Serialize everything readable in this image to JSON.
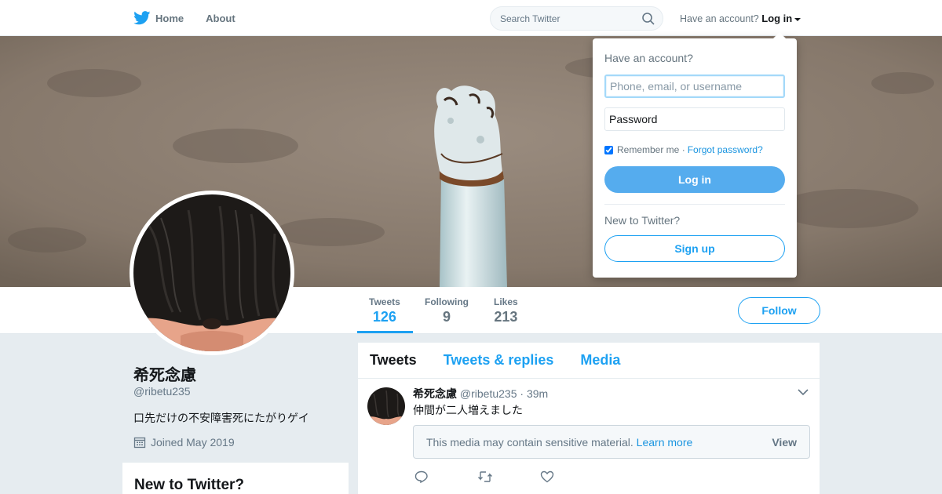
{
  "nav": {
    "home_label": "Home",
    "about_label": "About",
    "search_placeholder": "Search Twitter",
    "have_account_text": "Have an account?",
    "login_link": "Log in"
  },
  "profile": {
    "name": "希死念慮",
    "handle": "@ribetu235",
    "bio": "口先だけの不安障害死にたがりゲイ",
    "joined": "Joined May 2019"
  },
  "stats": [
    {
      "label": "Tweets",
      "value": "126",
      "active": true
    },
    {
      "label": "Following",
      "value": "9",
      "active": false
    },
    {
      "label": "Likes",
      "value": "213",
      "active": false
    }
  ],
  "follow_label": "Follow",
  "sidebar_card_title": "New to Twitter?",
  "timeline": {
    "tabs": [
      "Tweets",
      "Tweets & replies",
      "Media"
    ],
    "tweet": {
      "name": "希死念慮",
      "handle": "@ribetu235",
      "dot": "·",
      "time": "39m",
      "text": "仲間が二人増えました",
      "sensitive_text": "This media may contain sensitive material.",
      "learn_more": "Learn more",
      "view": "View"
    }
  },
  "login_dropdown": {
    "title": "Have an account?",
    "username_placeholder": "Phone, email, or username",
    "password_placeholder": "Password",
    "remember_me": "Remember me",
    "separator": "·",
    "forgot_password": "Forgot password?",
    "login_button": "Log in",
    "new_to_twitter": "New to Twitter?",
    "signup_button": "Sign up"
  },
  "colors": {
    "accent": "#1da1f2",
    "login_button": "#55acee",
    "background": "#e6ecf0"
  },
  "icons": [
    "twitter-bird-icon",
    "home-icon",
    "search-icon",
    "caret-down-icon",
    "calendar-icon",
    "chevron-down-icon",
    "reply-icon",
    "retweet-icon",
    "like-icon"
  ]
}
